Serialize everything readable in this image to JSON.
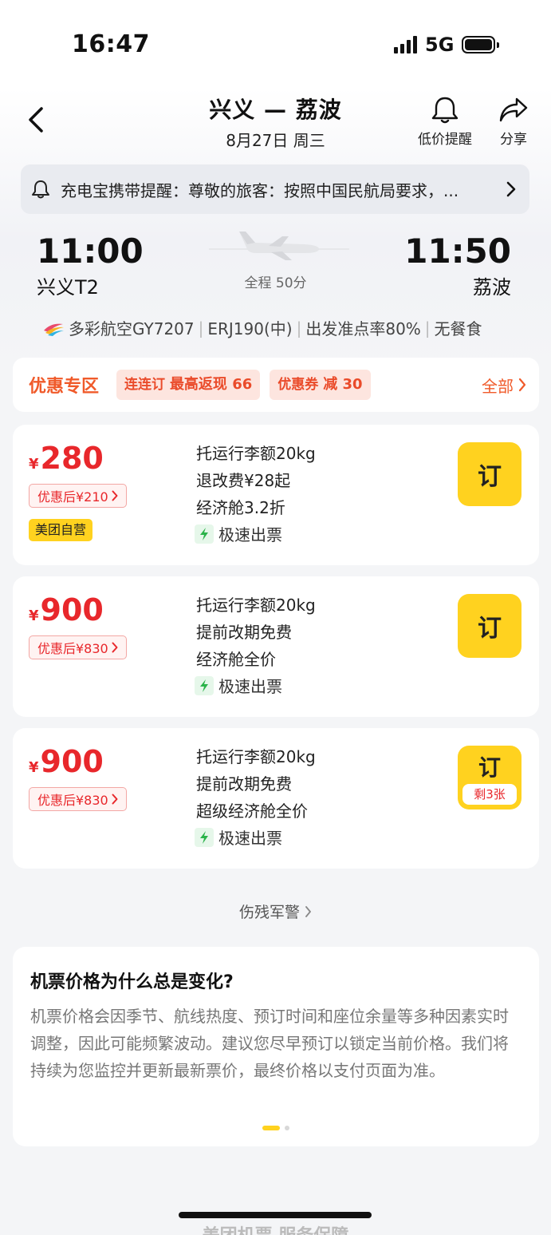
{
  "status_bar": {
    "time": "16:47",
    "network": "5G"
  },
  "header": {
    "route": "兴义 — 荔波",
    "date": "8月27日 周三",
    "actions": {
      "price_alert": "低价提醒",
      "share": "分享"
    }
  },
  "notice": {
    "text": "充电宝携带提醒：尊敬的旅客：按照中国民航局要求，..."
  },
  "flight": {
    "departure_time": "11:00",
    "departure_airport": "兴义T2",
    "arrival_time": "11:50",
    "arrival_airport": "荔波",
    "duration": "全程 50分",
    "airline": "多彩航空GY7207",
    "aircraft": "ERJ190(中)",
    "on_time": "出发准点率80%",
    "meal": "无餐食"
  },
  "promo": {
    "title": "优惠专区",
    "tags": [
      {
        "name": "连连订",
        "detail": "最高返现 66"
      },
      {
        "name": "优惠券",
        "detail": "减 30"
      }
    ],
    "all": "全部"
  },
  "fares": [
    {
      "currency": "¥",
      "price": "280",
      "discount": "优惠后¥210",
      "badge": "美团自营",
      "features": [
        "托运行李额20kg",
        "退改费¥28起",
        "经济舱3.2折"
      ],
      "fast": "极速出票",
      "book": "订",
      "remaining": ""
    },
    {
      "currency": "¥",
      "price": "900",
      "discount": "优惠后¥830",
      "badge": "",
      "features": [
        "托运行李额20kg",
        "提前改期免费",
        "经济舱全价"
      ],
      "fast": "极速出票",
      "book": "订",
      "remaining": ""
    },
    {
      "currency": "¥",
      "price": "900",
      "discount": "优惠后¥830",
      "badge": "",
      "features": [
        "托运行李额20kg",
        "提前改期免费",
        "超级经济舱全价"
      ],
      "fast": "极速出票",
      "book": "订",
      "remaining": "剩3张"
    }
  ],
  "more_link": "伤残军警",
  "faq": {
    "title": "机票价格为什么总是变化?",
    "body": "机票价格会因季节、航线热度、预订时间和座位余量等多种因素实时调整，因此可能频繁波动。建议您尽早预订以锁定当前价格。我们将持续为您监控并更新最新票价，最终价格以支付页面为准。"
  },
  "footer": {
    "partial_text": "美团机票 服务保障"
  },
  "colors": {
    "accent": "#ffd21f",
    "price": "#e8272b",
    "promo": "#f05a2a"
  }
}
